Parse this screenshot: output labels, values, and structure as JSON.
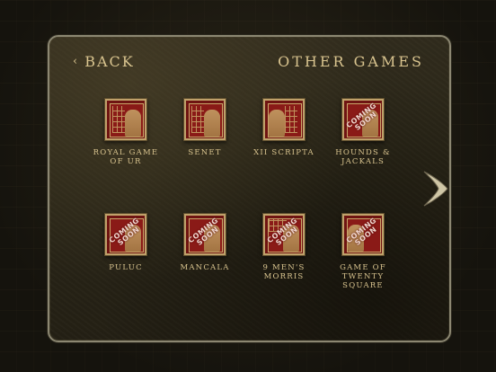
{
  "header": {
    "back_label": "BACK",
    "title": "OTHER GAMES"
  },
  "games": [
    {
      "label": "ROYAL GAME\nOF UR",
      "coming_soon": false,
      "icon": "figure-seated-icon"
    },
    {
      "label": "SENET",
      "coming_soon": false,
      "icon": "figure-seated-icon"
    },
    {
      "label": "XII SCRIPTA",
      "coming_soon": false,
      "icon": "figure-seated-icon"
    },
    {
      "label": "HOUNDS & JACKALS",
      "coming_soon": true,
      "icon": "figure-seated-icon"
    },
    {
      "label": "PULUC",
      "coming_soon": true,
      "icon": "figure-seated-icon"
    },
    {
      "label": "MANCALA",
      "coming_soon": true,
      "icon": "figure-seated-icon"
    },
    {
      "label": "9 MEN'S\nMORRIS",
      "coming_soon": true,
      "icon": "figure-seated-icon"
    },
    {
      "label": "GAME OF\nTWENTY\nSQUARE",
      "coming_soon": true,
      "icon": "figure-seated-icon"
    }
  ],
  "coming_soon_text": "COMING SOON",
  "navigation": {
    "next_icon": "chevron-right-icon"
  },
  "colors": {
    "accent_gold": "#d9c48f",
    "tile_red": "#6f1412",
    "frame_border": "#8c8772"
  }
}
